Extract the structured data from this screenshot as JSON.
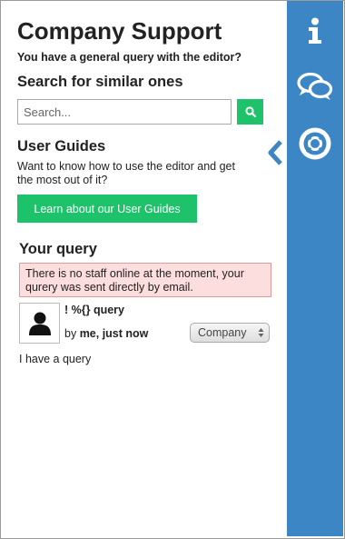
{
  "panel": {
    "title": "Company Support",
    "subtitle": "You have a general query with the editor?",
    "search": {
      "heading": "Search for similar ones",
      "placeholder": "Search...",
      "value": "",
      "button_icon": "search-icon"
    },
    "guides": {
      "heading": "User Guides",
      "description": "Want to know how to use the editor and get the most out of it?",
      "button_label": "Learn about our User Guides"
    },
    "query": {
      "heading": "Your query",
      "alert": "There is no staff online at the moment, your qurery was sent directly by email.",
      "title": "! %{} query",
      "by_prefix": "by",
      "author_time": "me, just now",
      "category_selected": "Company",
      "body": "I have a query"
    }
  },
  "rail": {
    "icons": [
      "info-icon",
      "chat-bubbles-icon",
      "lifebuoy-icon"
    ],
    "collapse_icon": "chevron-left-icon"
  },
  "colors": {
    "rail": "#3d86c6",
    "accent_green": "#1ec26a",
    "alert_bg": "#fddede",
    "alert_border": "#e59a9a"
  }
}
